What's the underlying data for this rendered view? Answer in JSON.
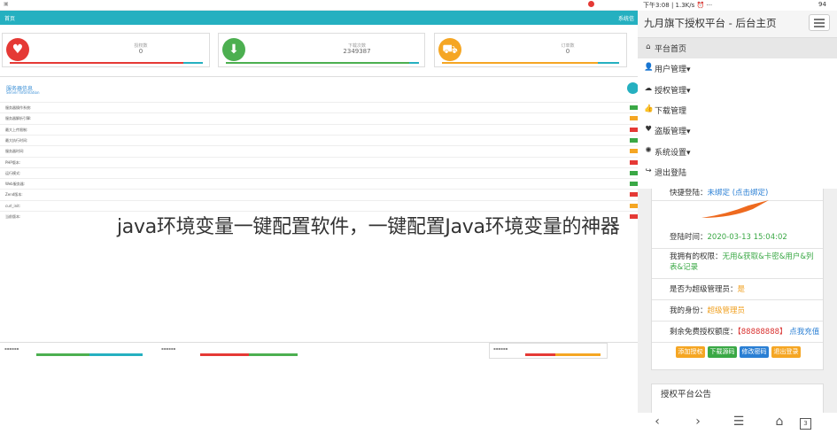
{
  "headline": "java环境变量一键配置软件，一键配置Java环境变量的神器",
  "desktop": {
    "nav": {
      "crumb": "首页",
      "right": "系统信"
    },
    "stats": [
      {
        "icon": "heart-icon",
        "color": "#e53935",
        "label": "授权数",
        "value": "0"
      },
      {
        "icon": "download-icon",
        "color": "#4caf50",
        "label": "下载次数",
        "value": "2349387"
      },
      {
        "icon": "cart-icon",
        "color": "#f5a623",
        "label": "订单数",
        "value": "0"
      }
    ],
    "info_title": "服务器信息",
    "info_subtitle": "Server Information",
    "rows": [
      "服务器操作系统:",
      "服务器解析引擎:",
      "最大上传限制:",
      "最大执行时间:",
      "服务器时间:",
      "PHP版本:",
      "运行模式:",
      "Web服务器:",
      "Zend版本:",
      "curl_init:",
      "当前版本:"
    ]
  },
  "phone": {
    "status_left": "下午3:08 | 1.3K/s ⏰ ···",
    "status_right": "94",
    "title": "九月旗下授权平台 - 后台主页",
    "menu": [
      {
        "icon": "home-icon",
        "glyph": "⌂",
        "label": "平台首页",
        "active": true
      },
      {
        "icon": "user-icon",
        "glyph": "👤",
        "label": "用户管理▾",
        "active": false
      },
      {
        "icon": "cloud-icon",
        "glyph": "☁",
        "label": "授权管理▾",
        "active": false
      },
      {
        "icon": "thumb-icon",
        "glyph": "👍",
        "label": "下载管理",
        "active": false
      },
      {
        "icon": "heart-icon",
        "glyph": "♥",
        "label": "盗版管理▾",
        "active": false
      },
      {
        "icon": "gear-icon",
        "glyph": "✺",
        "label": "系统设置▾",
        "active": false
      },
      {
        "icon": "logout-icon",
        "glyph": "↪",
        "label": "退出登陆",
        "active": false
      }
    ],
    "panel": {
      "quick_login_label": "快捷登陆：",
      "quick_login_value": "未绑定 (点击绑定)",
      "time_label": "登陆时间：",
      "time_value": "2020-03-13 15:04:02",
      "perm_label": "我拥有的权限：",
      "perm_value": "无用&获取&卡密&用户&列表&记录",
      "super_label": "是否为超级管理员：",
      "super_value": "是",
      "identity_label": "我的身份：",
      "identity_value": "超级管理员",
      "quota_label": "剩余免费授权额度：",
      "quota_value": "【88888888】",
      "quota_link": "点我充值",
      "buttons": [
        {
          "label": "添加授权",
          "color": "#f5a623"
        },
        {
          "label": "下载源码",
          "color": "#3aa845"
        },
        {
          "label": "修改密码",
          "color": "#2a7fd4"
        },
        {
          "label": "退出登录",
          "color": "#f5a623"
        }
      ]
    },
    "notice_title": "授权平台公告",
    "bottom_nav": {
      "back": "‹",
      "forward": "›",
      "menu": "☰",
      "home": "⌂",
      "tabs": "3"
    }
  }
}
